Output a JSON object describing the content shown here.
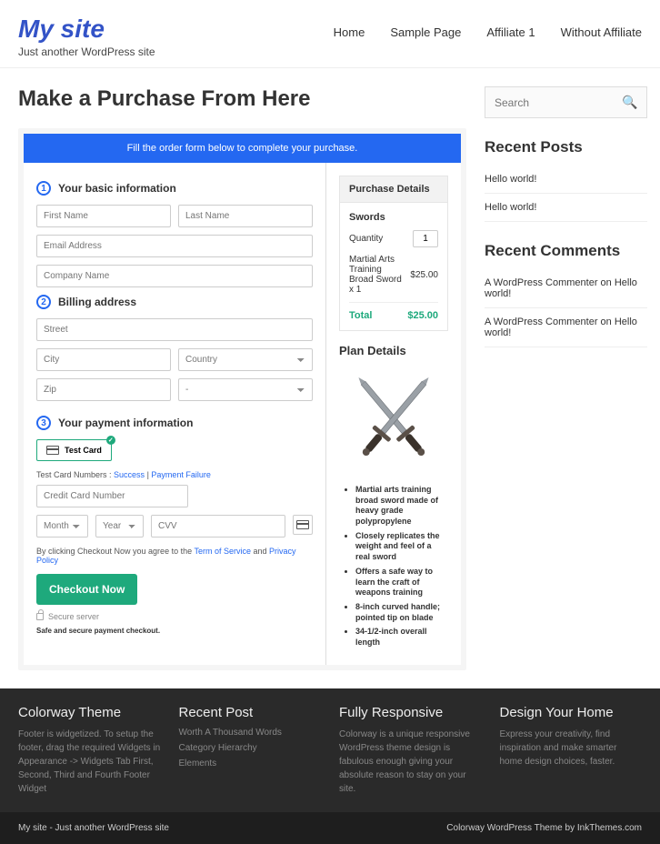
{
  "site": {
    "title": "My site",
    "tagline": "Just another WordPress site"
  },
  "nav": [
    "Home",
    "Sample Page",
    "Affiliate 1",
    "Without Affiliate"
  ],
  "page": {
    "title": "Make a Purchase From Here"
  },
  "checkout": {
    "banner": "Fill the order form below to complete your purchase.",
    "steps": {
      "s1": "Your basic information",
      "s2": "Billing address",
      "s3": "Your payment information"
    },
    "placeholders": {
      "first": "First Name",
      "last": "Last Name",
      "email": "Email Address",
      "company": "Company Name",
      "street": "Street",
      "city": "City",
      "country": "Country",
      "zip": "Zip",
      "dash": "-",
      "cardnum": "Credit Card Number",
      "month": "Month",
      "year": "Year",
      "cvv": "CVV"
    },
    "test_card_label": "Test  Card",
    "help1_pre": "Test Card Numbers :",
    "help1_success": "Success",
    "help1_sep": " | ",
    "help1_fail": "Payment Failure",
    "terms_pre": "By clicking Checkout Now you agree to the ",
    "terms_tos": "Term of Service",
    "terms_and": " and ",
    "terms_pp": "Privacy Policy",
    "checkout_btn": "Checkout Now",
    "secure": "Secure server",
    "safe_msg": "Safe and secure payment checkout."
  },
  "purchase": {
    "heading": "Purchase Details",
    "section": "Swords",
    "qty_label": "Quantity",
    "qty_val": "1",
    "item_name": "Martial Arts Training Broad Sword x 1",
    "item_price": "$25.00",
    "total_label": "Total",
    "total_val": "$25.00",
    "plan_title": "Plan Details",
    "bullets": [
      "Martial arts training broad sword made of heavy grade polypropylene",
      "Closely replicates the weight and feel of a real sword",
      "Offers a safe way to learn the craft of weapons training",
      "8-inch curved handle; pointed tip on blade",
      "34-1/2-inch overall length"
    ]
  },
  "sidebar": {
    "search_ph": "Search",
    "recent_posts_h": "Recent Posts",
    "recent_posts": [
      "Hello world!",
      "Hello world!"
    ],
    "recent_comments_h": "Recent Comments",
    "recent_comments": [
      "A WordPress Commenter on Hello world!",
      "A WordPress Commenter on Hello world!"
    ]
  },
  "footer": {
    "cols": [
      {
        "title": "Colorway Theme",
        "text": "Footer is widgetized. To setup the footer, drag the required Widgets in Appearance -> Widgets Tab First, Second, Third and Fourth Footer Widget"
      },
      {
        "title": "Recent Post",
        "items": [
          "Worth A Thousand Words",
          "Category Hierarchy",
          "Elements"
        ]
      },
      {
        "title": "Fully Responsive",
        "text": "Colorway is a unique responsive WordPress theme design is fabulous enough giving your absolute reason to stay on your site."
      },
      {
        "title": "Design Your Home",
        "text": "Express your creativity, find inspiration and make smarter home design choices, faster."
      }
    ]
  },
  "subfooter": {
    "left": "My site - Just another WordPress site",
    "right": "Colorway WordPress Theme by InkThemes.com"
  }
}
